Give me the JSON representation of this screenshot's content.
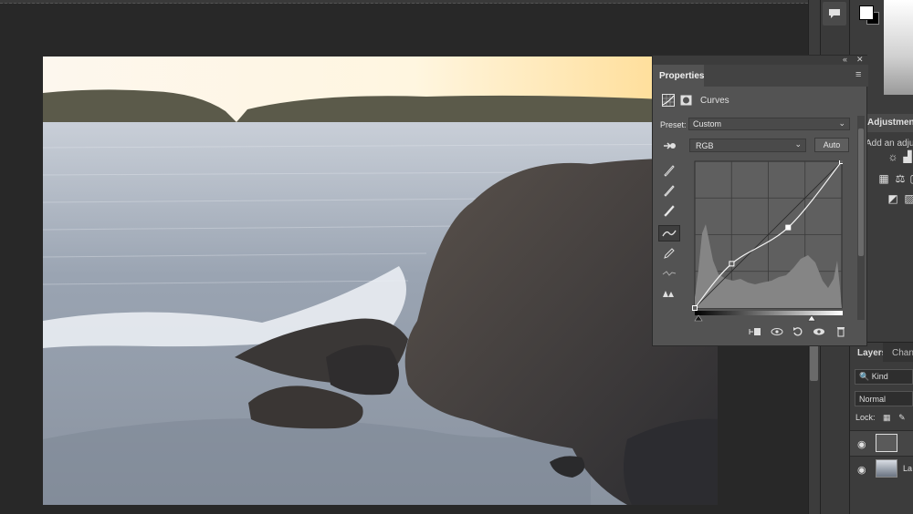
{
  "app": {
    "colors": {
      "canvas_bg": "#282828",
      "panel_bg": "#535353",
      "panel_dark": "#3c3c3c",
      "accent_text": "#dcdcdc"
    }
  },
  "properties_panel": {
    "tab_label": "Properties",
    "collapse_glyph": "«",
    "close_glyph": "✕",
    "menu_glyph": "≡",
    "adjustment_title": "Curves",
    "preset_label": "Preset:",
    "preset_value": "Custom",
    "channel_value": "RGB",
    "auto_label": "Auto",
    "tools": [
      "on-image-adjust-icon",
      "black-point-eyedropper-icon",
      "gray-point-eyedropper-icon",
      "white-point-eyedropper-icon",
      "curve-point-icon",
      "pencil-icon",
      "smooth-icon",
      "clipping-warning-icon"
    ],
    "bottom_buttons": [
      "clip-to-layer-icon",
      "view-previous-icon",
      "reset-icon",
      "visibility-icon",
      "trash-icon"
    ]
  },
  "curve": {
    "points": [
      [
        0,
        0
      ],
      [
        64,
        77
      ],
      [
        162,
        140
      ],
      [
        255,
        255
      ]
    ]
  },
  "right_panel": {
    "adjustments_tab": "Adjustments",
    "adjustments_hint": "Add an adjustment",
    "layers_tab": "Layers",
    "channels_tab": "Channels",
    "kind_label": "Kind",
    "blend_mode": "Normal",
    "lock_label": "Lock:",
    "layers": [
      {
        "name": "",
        "type": "adjustment"
      },
      {
        "name": "La",
        "type": "image"
      }
    ]
  }
}
